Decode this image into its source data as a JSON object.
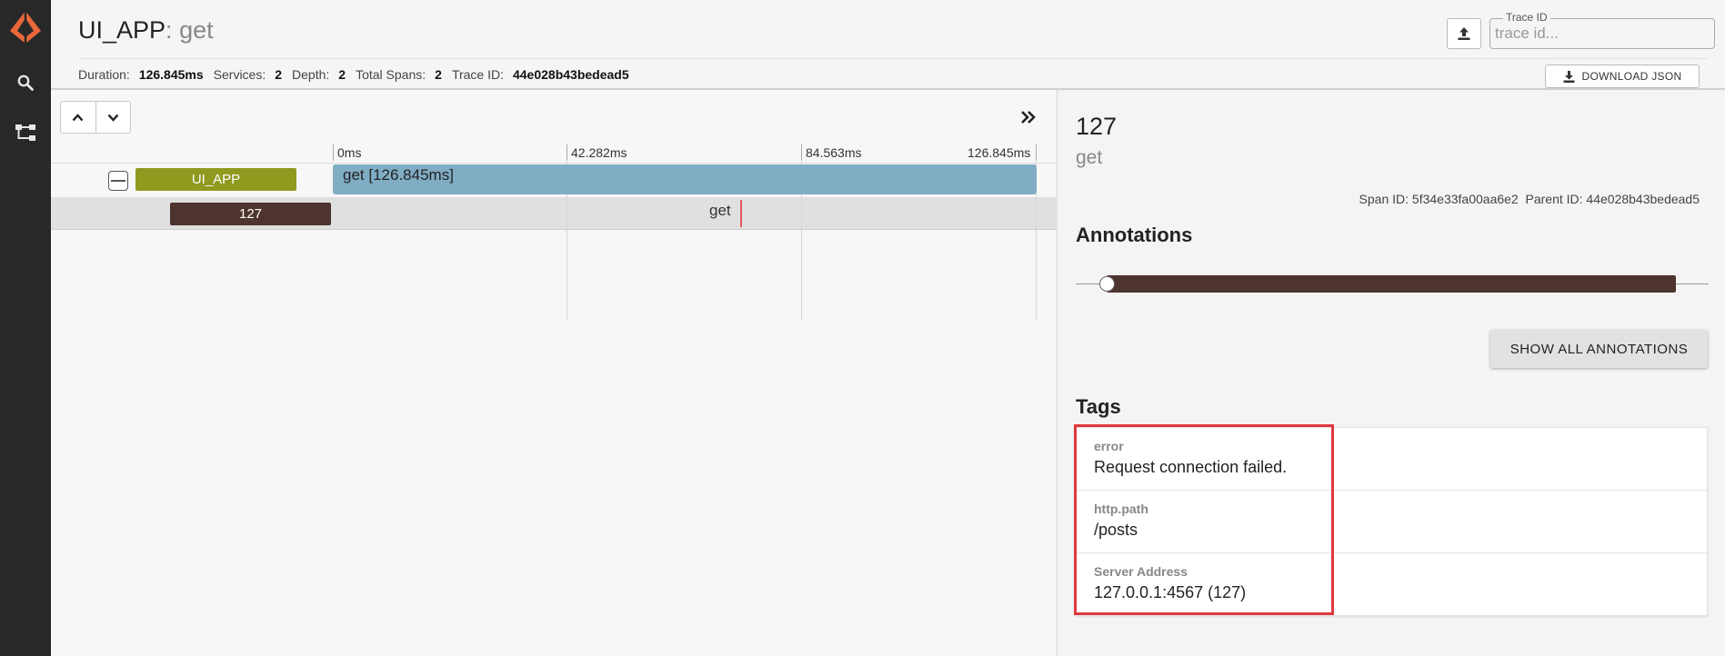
{
  "app": {
    "service_name": "UI_APP",
    "title_separator": ":",
    "span_name": "get"
  },
  "rail": {
    "items": [
      {
        "icon": "zipkin-logo-icon"
      },
      {
        "icon": "search-icon"
      },
      {
        "icon": "dependencies-icon"
      }
    ]
  },
  "summary": {
    "duration_label": "Duration:",
    "duration_value": "126.845ms",
    "services_label": "Services:",
    "services_value": "2",
    "depth_label": "Depth:",
    "depth_value": "2",
    "total_spans_label": "Total Spans:",
    "total_spans_value": "2",
    "trace_id_label": "Trace ID:",
    "trace_id_value": "44e028b43bedead5"
  },
  "trace_search": {
    "label": "Trace ID",
    "placeholder": "trace id...",
    "value": ""
  },
  "toolbar": {
    "download_label": "DOWNLOAD JSON",
    "upload_icon": "upload-icon",
    "download_icon": "download-icon"
  },
  "timeline": {
    "up_icon": "chevron-up-icon",
    "down_icon": "chevron-down-icon",
    "expand_icon": "double-chevron-right-icon",
    "ticks": [
      "0ms",
      "42.282ms",
      "84.563ms",
      "126.845ms"
    ],
    "rows": [
      {
        "service": "UI_APP",
        "service_color": "#8f9a1f",
        "label": "get [126.845ms]",
        "bar_color": "#80adc4"
      },
      {
        "service": "127",
        "service_color": "#4e342e",
        "label": "get",
        "marker_color": "#e05a5a"
      }
    ]
  },
  "detail": {
    "span_title": "127",
    "span_name": "get",
    "span_id_label": "Span ID:",
    "span_id": "5f34e33fa00aa6e2",
    "parent_id_label": "Parent ID:",
    "parent_id": "44e028b43bedead5",
    "annotations_title": "Annotations",
    "annotation_bar_color": "#4e342e",
    "show_all_label": "SHOW ALL ANNOTATIONS",
    "tags_title": "Tags",
    "tags": [
      {
        "key": "error",
        "value": "Request connection failed."
      },
      {
        "key": "http.path",
        "value": "/posts"
      },
      {
        "key": "Server Address",
        "value": "127.0.0.1:4567 (127)"
      }
    ]
  },
  "colors": {
    "rail_bg": "#282828",
    "logo": "#e8683a",
    "highlight": "#e0393e"
  }
}
